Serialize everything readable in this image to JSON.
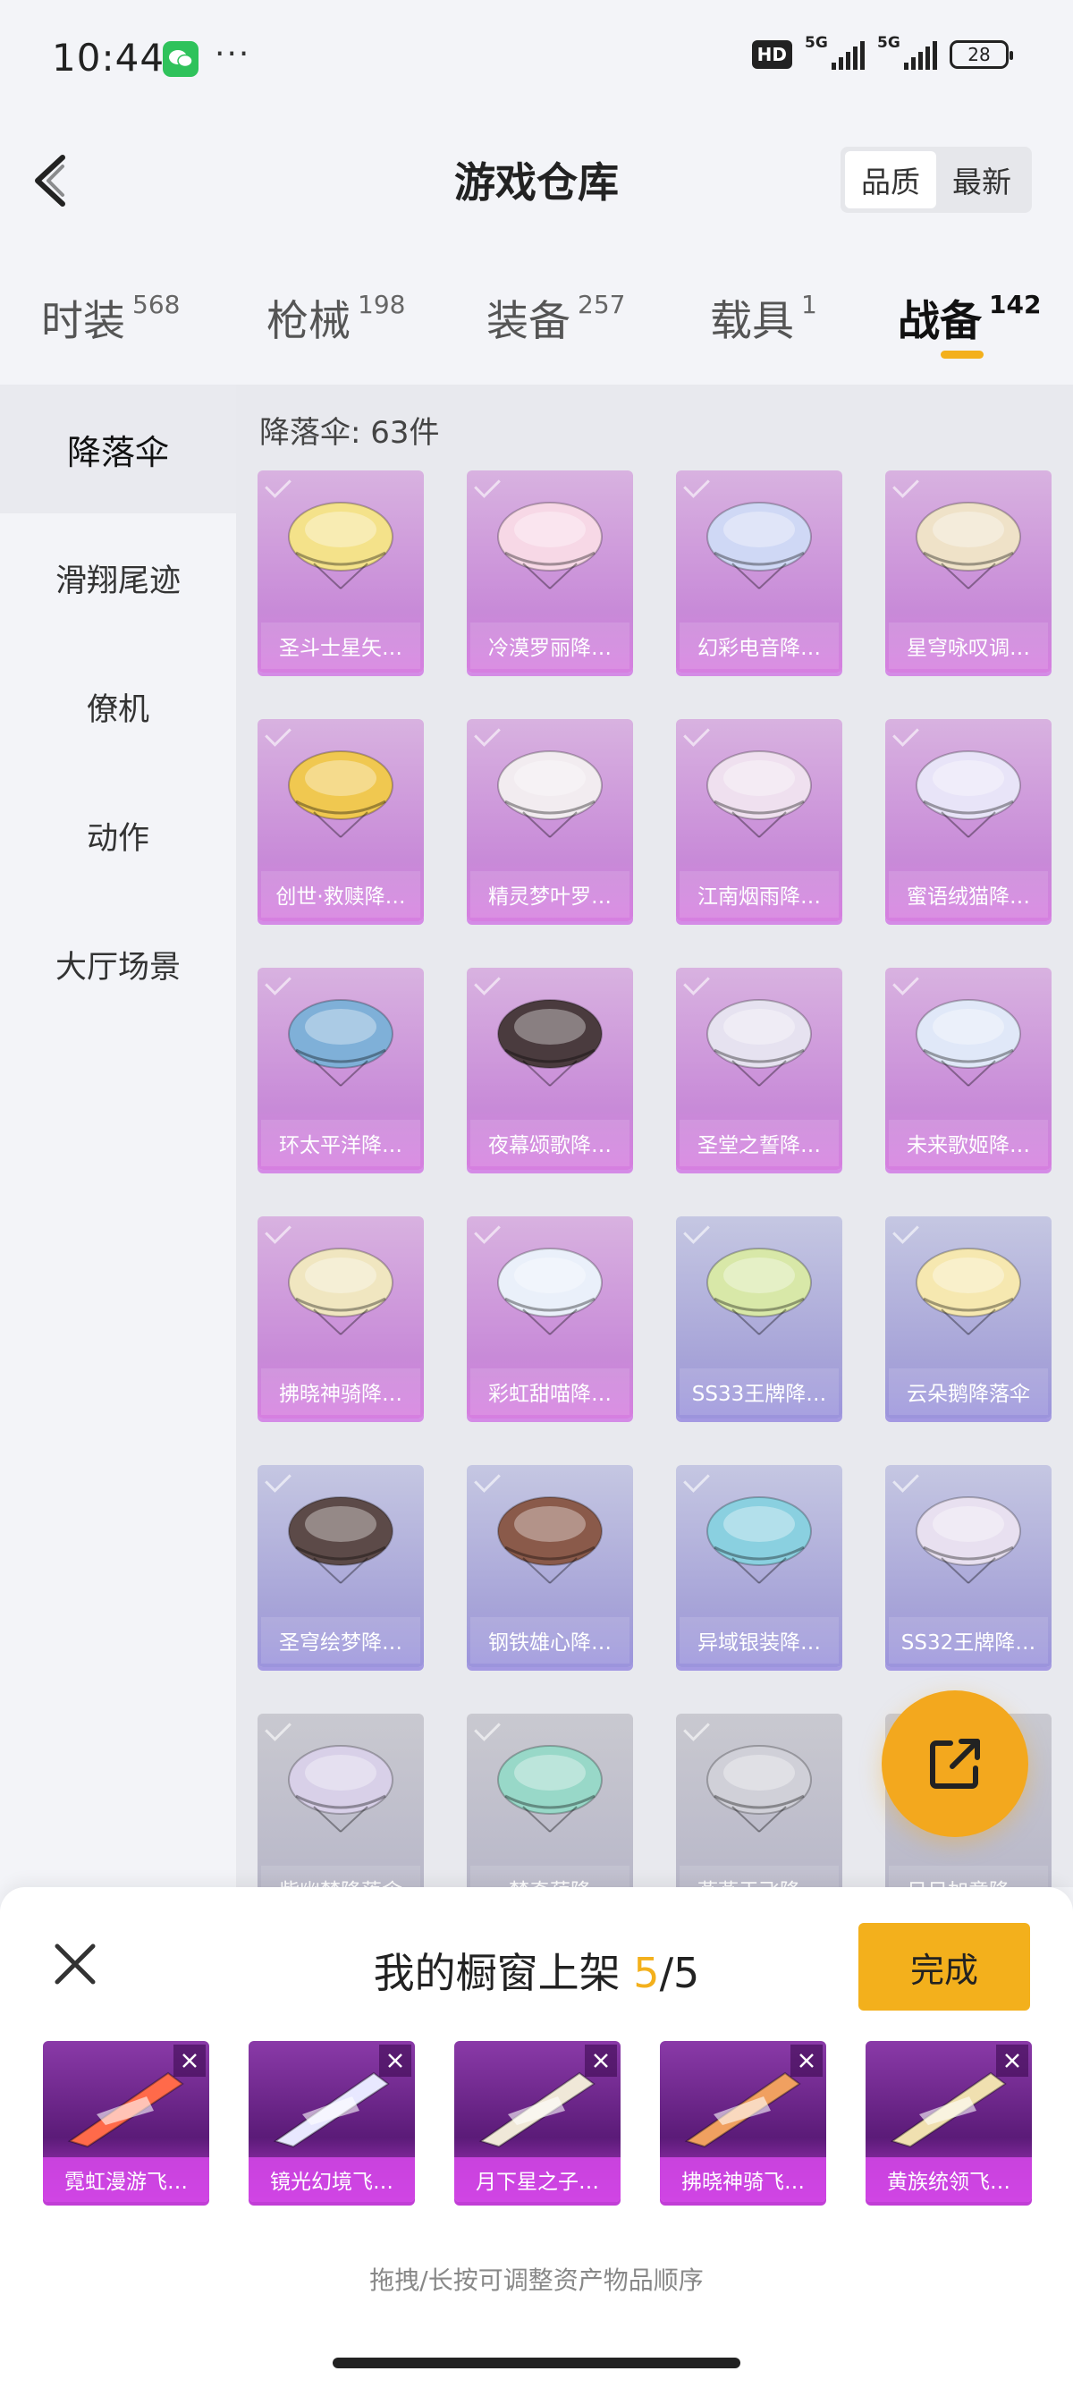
{
  "status_bar": {
    "time": "10:44",
    "more": "···",
    "hd": "HD",
    "net1": "5G",
    "net2": "5G",
    "battery": "28"
  },
  "header": {
    "title": "游戏仓库",
    "sort_options": [
      "品质",
      "最新"
    ]
  },
  "tabs": [
    {
      "label": "时装",
      "count": "568"
    },
    {
      "label": "枪械",
      "count": "198"
    },
    {
      "label": "装备",
      "count": "257"
    },
    {
      "label": "载具",
      "count": "1"
    },
    {
      "label": "战备",
      "count": "142"
    }
  ],
  "sidebar": [
    "降落伞",
    "滑翔尾迹",
    "僚机",
    "动作",
    "大厅场景"
  ],
  "main": {
    "count_text": "降落伞: 63件",
    "items": [
      {
        "label": "圣斗士星矢…",
        "rarity": "pink"
      },
      {
        "label": "冷漠罗丽降…",
        "rarity": "pink"
      },
      {
        "label": "幻彩电音降…",
        "rarity": "pink"
      },
      {
        "label": "星穹咏叹调…",
        "rarity": "pink"
      },
      {
        "label": "创世·救赎降…",
        "rarity": "pink"
      },
      {
        "label": "精灵梦叶罗…",
        "rarity": "pink"
      },
      {
        "label": "江南烟雨降…",
        "rarity": "pink"
      },
      {
        "label": "蜜语绒猫降…",
        "rarity": "pink"
      },
      {
        "label": "环太平洋降…",
        "rarity": "pink"
      },
      {
        "label": "夜幕颂歌降…",
        "rarity": "pink"
      },
      {
        "label": "圣堂之誓降…",
        "rarity": "pink"
      },
      {
        "label": "未来歌姬降…",
        "rarity": "pink"
      },
      {
        "label": "拂晓神骑降…",
        "rarity": "pink"
      },
      {
        "label": "彩虹甜喵降…",
        "rarity": "pink"
      },
      {
        "label": "SS33王牌降…",
        "rarity": "blue"
      },
      {
        "label": "云朵鹅降落伞",
        "rarity": "blue"
      },
      {
        "label": "圣穹绘梦降…",
        "rarity": "blue"
      },
      {
        "label": "钢铁雄心降…",
        "rarity": "blue"
      },
      {
        "label": "异域银装降…",
        "rarity": "blue"
      },
      {
        "label": "SS32王牌降…",
        "rarity": "blue"
      },
      {
        "label": "紫幽梦降落伞",
        "rarity": "gray"
      },
      {
        "label": "一梦奇葩降…",
        "rarity": "gray"
      },
      {
        "label": "燕燕于飞降…",
        "rarity": "gray"
      },
      {
        "label": "日日加意降…",
        "rarity": "gray"
      }
    ]
  },
  "sheet": {
    "title": "我的橱窗上架",
    "count_current": "5",
    "count_total": "/5",
    "done_label": "完成",
    "shelf": [
      {
        "label": "霓虹漫游飞…"
      },
      {
        "label": "镜光幻境飞…"
      },
      {
        "label": "月下星之子…"
      },
      {
        "label": "拂晓神骑飞…"
      },
      {
        "label": "黄族统领飞…"
      }
    ],
    "hint": "拖拽/长按可调整资产物品顺序"
  },
  "colors": {
    "accent": "#f3b01c",
    "rarity_pink": "#d67fe0",
    "rarity_blue": "#9c94dc",
    "rarity_purple": "#c13ed6"
  }
}
